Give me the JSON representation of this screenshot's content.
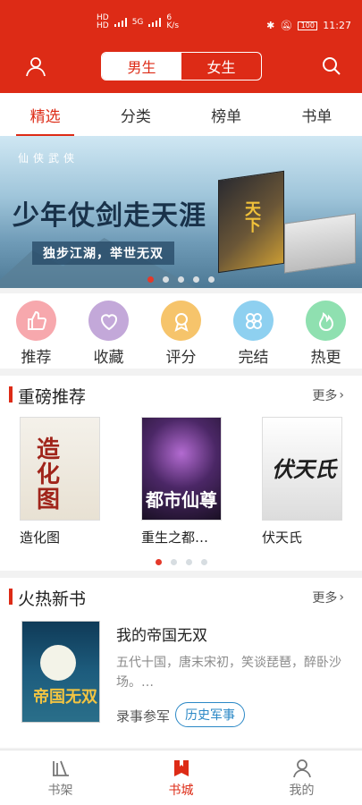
{
  "colors": {
    "brand": "#dd2b16",
    "tag": "#2b88c6"
  },
  "status_bar": {
    "sim1": "HD",
    "sim2": "HD",
    "network": "5G",
    "speed": "6",
    "speed_unit": "K/s",
    "battery": "100",
    "time": "11:27"
  },
  "header": {
    "toggle": [
      {
        "label": "男生",
        "active": true
      },
      {
        "label": "女生",
        "active": false
      }
    ]
  },
  "tabs": [
    {
      "label": "精选",
      "active": true
    },
    {
      "label": "分类",
      "active": false
    },
    {
      "label": "榜单",
      "active": false
    },
    {
      "label": "书单",
      "active": false
    }
  ],
  "banner": {
    "tagline_small": "仙侠武侠",
    "title": "少年仗剑走天涯",
    "subtitle": "独步江湖，举世无双",
    "book_name": "天下",
    "slide_count": 5,
    "active_slide": 0
  },
  "quick_links": [
    {
      "label": "推荐",
      "icon": "thumbs-up-icon",
      "color": "#f7a8ad"
    },
    {
      "label": "收藏",
      "icon": "heart-icon",
      "color": "#c3a8d9"
    },
    {
      "label": "评分",
      "icon": "medal-icon",
      "color": "#f6c46b"
    },
    {
      "label": "完结",
      "icon": "clover-icon",
      "color": "#8ed0f0"
    },
    {
      "label": "热更",
      "icon": "flame-icon",
      "color": "#8fe0b0"
    }
  ],
  "featured": {
    "title": "重磅推荐",
    "more": "更多",
    "books": [
      {
        "title": "造化图",
        "cover_text": "造化图"
      },
      {
        "title": "重生之都…",
        "cover_text": "都市仙尊"
      },
      {
        "title": "伏天氏",
        "cover_text": "伏天氏"
      }
    ],
    "page_count": 4,
    "active_page": 0
  },
  "new_books": {
    "title": "火热新书",
    "more": "更多",
    "book": {
      "title": "我的帝国无双",
      "cover_text": "帝国无双",
      "description": "五代十国，唐末宋初，笑谈琵琶，醉卧沙场。…",
      "author": "录事参军",
      "tag": "历史军事"
    }
  },
  "bottom_nav": [
    {
      "label": "书架",
      "icon": "bookshelf-icon",
      "active": false
    },
    {
      "label": "书城",
      "icon": "bookstore-icon",
      "active": true
    },
    {
      "label": "我的",
      "icon": "profile-icon",
      "active": false
    }
  ]
}
